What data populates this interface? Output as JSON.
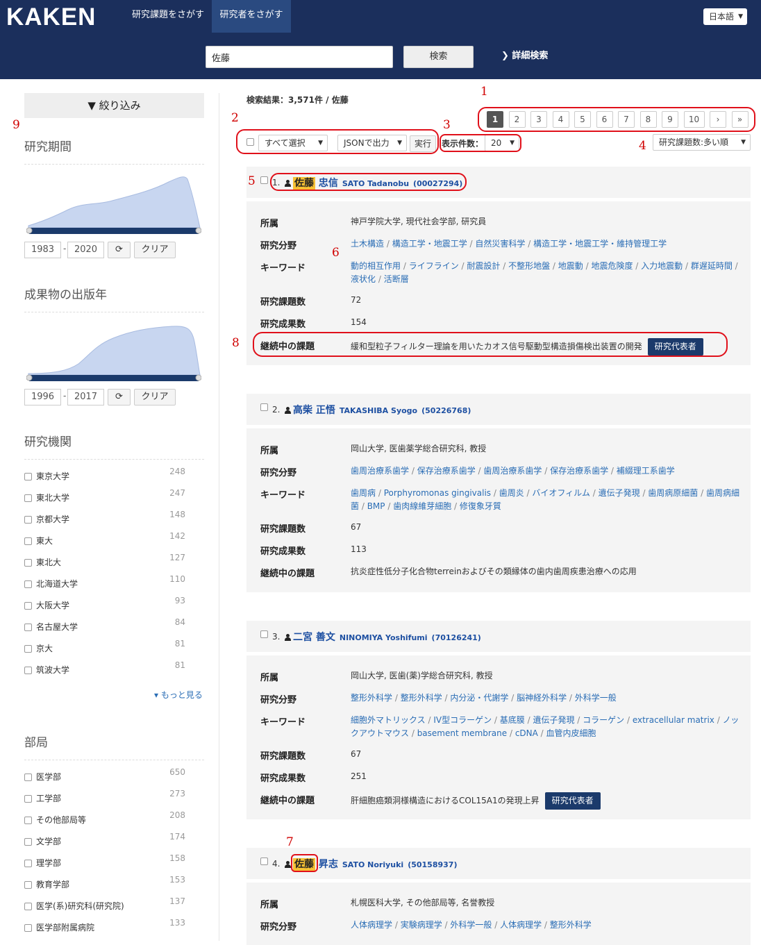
{
  "header": {
    "logo": "KAKEN",
    "tab_projects": "研究課題をさがす",
    "tab_researchers": "研究者をさがす",
    "language": "日本語",
    "search_value": "佐藤",
    "search_button": "検索",
    "advanced_search": "詳細検索"
  },
  "sidebar": {
    "filter_title": "絞り込み",
    "period": {
      "title": "研究期間",
      "from": "1983",
      "to": "2020",
      "clear": "クリア"
    },
    "pubyear": {
      "title": "成果物の出版年",
      "from": "1996",
      "to": "2017",
      "clear": "クリア"
    },
    "institutions": {
      "title": "研究機関",
      "items": [
        {
          "label": "東京大学",
          "count": "248"
        },
        {
          "label": "東北大学",
          "count": "247"
        },
        {
          "label": "京都大学",
          "count": "148"
        },
        {
          "label": "東大",
          "count": "142"
        },
        {
          "label": "東北大",
          "count": "127"
        },
        {
          "label": "北海道大学",
          "count": "110"
        },
        {
          "label": "大阪大学",
          "count": "93"
        },
        {
          "label": "名古屋大学",
          "count": "84"
        },
        {
          "label": "京大",
          "count": "81"
        },
        {
          "label": "筑波大学",
          "count": "81"
        }
      ],
      "more": "もっと見る"
    },
    "departments": {
      "title": "部局",
      "items": [
        {
          "label": "医学部",
          "count": "650"
        },
        {
          "label": "工学部",
          "count": "273"
        },
        {
          "label": "その他部局等",
          "count": "208"
        },
        {
          "label": "文学部",
          "count": "174"
        },
        {
          "label": "理学部",
          "count": "158"
        },
        {
          "label": "教育学部",
          "count": "153"
        },
        {
          "label": "医学(系)研究科(研究院)",
          "count": "137"
        },
        {
          "label": "医学部附属病院",
          "count": "133"
        }
      ]
    }
  },
  "results": {
    "summary": "検索結果：3,571件 / 佐藤",
    "pages": [
      "1",
      "2",
      "3",
      "4",
      "5",
      "6",
      "7",
      "8",
      "9",
      "10",
      "›",
      "»"
    ],
    "select_all": "すべて選択",
    "json_output": "JSONで出力",
    "run": "実行",
    "per_page_label": "表示件数：",
    "per_page": "20",
    "sort": "研究課題数:多い順",
    "labels": {
      "affiliation": "所属",
      "field": "研究分野",
      "keyword": "キーワード",
      "projects": "研究課題数",
      "outputs": "研究成果数",
      "ongoing": "継続中の課題",
      "rep_badge": "研究代表者"
    },
    "items": [
      {
        "num": "1.",
        "name_hl": "佐藤",
        "name_rest": "忠信",
        "en": "SATO Tadanobu",
        "id": "(00027294)",
        "affiliation": "神戸学院大学, 現代社会学部, 研究員",
        "fields": [
          "土木構造",
          "構造工学・地震工学",
          "自然災害科学",
          "構造工学・地震工学・維持管理工学"
        ],
        "keywords": [
          "動的相互作用",
          "ライフライン",
          "耐震設計",
          "不整形地盤",
          "地震動",
          "地震危険度",
          "入力地震動",
          "群遅延時間",
          "液状化",
          "活断層"
        ],
        "projects": "72",
        "outputs": "154",
        "ongoing": "緩和型粒子フィルター理論を用いたカオス信号駆動型構造損傷検出装置の開発"
      },
      {
        "num": "2.",
        "name_hl": "",
        "name_rest": "高柴 正悟",
        "en": "TAKASHIBA Syogo",
        "id": "(50226768)",
        "affiliation": "岡山大学, 医歯薬学総合研究科, 教授",
        "fields": [
          "歯周治療系歯学",
          "保存治療系歯学",
          "歯周治療系歯学",
          "保存治療系歯学",
          "補綴理工系歯学"
        ],
        "keywords": [
          "歯周病",
          "Porphyromonas gingivalis",
          "歯周炎",
          "バイオフィルム",
          "遺伝子発現",
          "歯周病原細菌",
          "歯周病細菌",
          "BMP",
          "歯肉線維芽細胞",
          "修復象牙質"
        ],
        "projects": "67",
        "outputs": "113",
        "ongoing": "抗炎症性低分子化合物terreinおよびその類縁体の歯内歯周疾患治療への応用"
      },
      {
        "num": "3.",
        "name_hl": "",
        "name_rest": "二宮 善文",
        "en": "NINOMIYA Yoshifumi",
        "id": "(70126241)",
        "affiliation": "岡山大学, 医歯(薬)学総合研究科, 教授",
        "fields": [
          "整形外科学",
          "整形外科学",
          "内分泌・代謝学",
          "脳神経外科学",
          "外科学一般"
        ],
        "keywords": [
          "細胞外マトリックス",
          "IV型コラーゲン",
          "基底膜",
          "遺伝子発現",
          "コラーゲン",
          "extracellular matrix",
          "ノックアウトマウス",
          "basement membrane",
          "cDNA",
          "血管内皮細胞"
        ],
        "projects": "67",
        "outputs": "251",
        "ongoing": "肝細胞癌類洞様構造におけるCOL15A1の発現上昇"
      },
      {
        "num": "4.",
        "name_hl": "佐藤",
        "name_rest": "昇志",
        "en": "SATO Noriyuki",
        "id": "(50158937)",
        "affiliation": "札幌医科大学, その他部局等, 名誉教授",
        "fields": [
          "人体病理学",
          "実験病理学",
          "外科学一般",
          "人体病理学",
          "整形外科学"
        ]
      }
    ]
  },
  "annotations": [
    "1",
    "2",
    "3",
    "4",
    "5",
    "6",
    "7",
    "8",
    "9"
  ]
}
